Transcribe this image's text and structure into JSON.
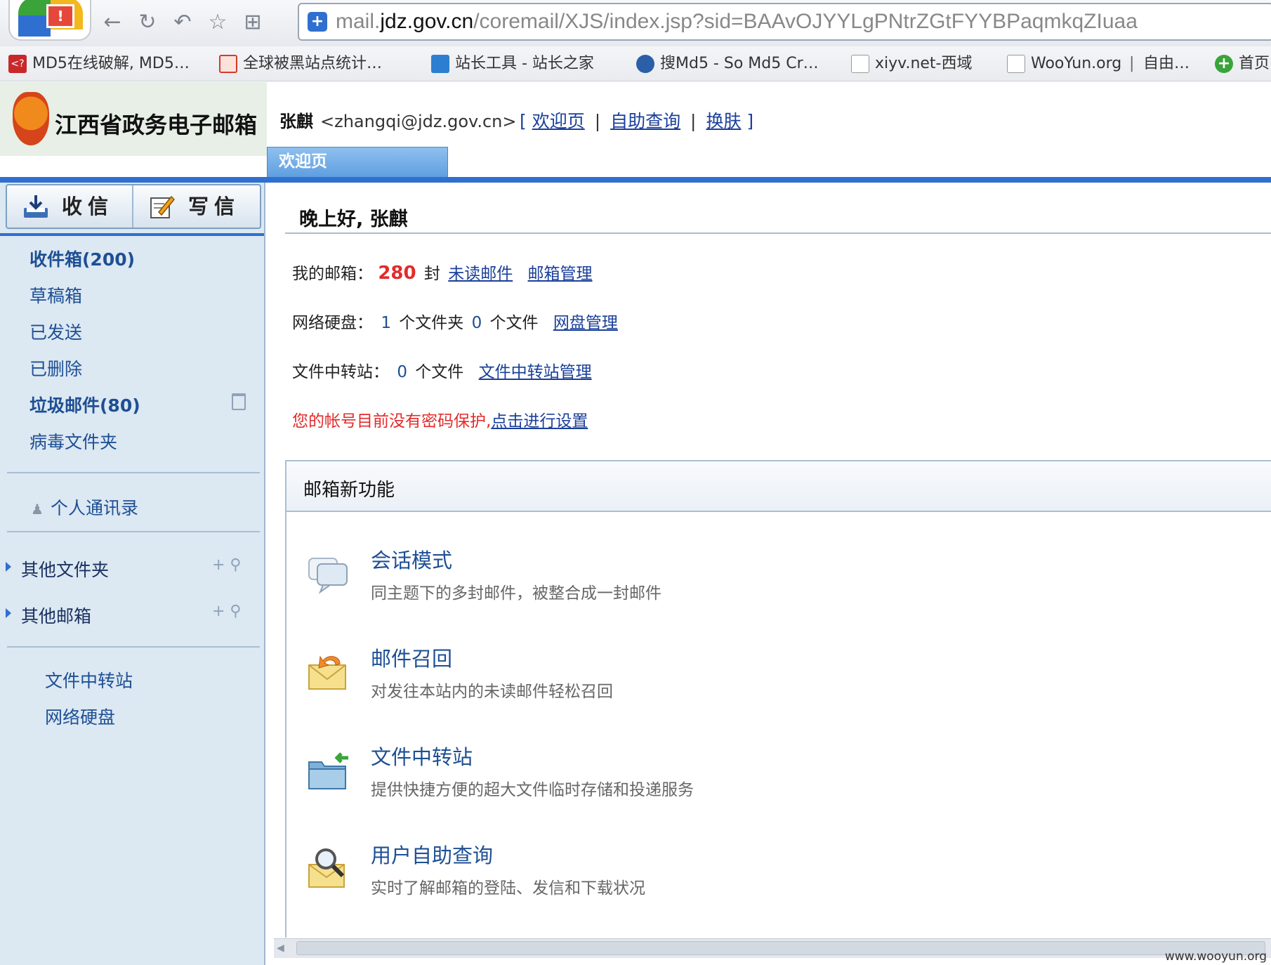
{
  "browser": {
    "url_prefix": "mail.",
    "url_domain": "jdz.gov.cn",
    "url_path": "/coremail/XJS/index.jsp?sid=BAAvOJYYLgPNtrZGtFYYBPaqmkqZIuaa",
    "bookmarks": [
      {
        "label": "MD5在线破解, MD5…",
        "icon_color": "#c8282a"
      },
      {
        "label": "全球被黑站点统计…",
        "icon_color": "#d63a2a"
      },
      {
        "label": "站长工具 - 站长之家",
        "icon_color": "#2c7fd0"
      },
      {
        "label": "搜Md5 - So Md5 Cr…",
        "icon_color": "#2b5fa8"
      },
      {
        "label": "xiyv.net-西域",
        "icon_color": "#ffffff"
      },
      {
        "label": "WooYun.org",
        "icon_color": "#ffffff"
      },
      {
        "label": "自由…",
        "icon_color": ""
      },
      {
        "label": "首页",
        "icon_color": "#3aa43a"
      }
    ],
    "bookmark_separator": "|"
  },
  "header": {
    "site_title": "江西省政务电子邮箱",
    "user_name": "张麒",
    "user_email": "<zhangqi@jdz.gov.cn>",
    "links": [
      "欢迎页",
      "自助查询",
      "换肤"
    ],
    "bracket_open": "[",
    "bracket_close": "]",
    "link_sep": "|",
    "active_tab": "欢迎页"
  },
  "sidebar": {
    "receive_label": "收信",
    "write_label": "写信",
    "folders": [
      "收件箱(200)",
      "草稿箱",
      "已发送",
      "已删除",
      "垃圾邮件(80)",
      "病毒文件夹"
    ],
    "contacts": "个人通讯录",
    "other_folders": "其他文件夹",
    "other_mailboxes": "其他邮箱",
    "tools": [
      "文件中转站",
      "网络硬盘"
    ],
    "action_icons": "+ ⚲"
  },
  "main": {
    "greeting": "晚上好, 张麒",
    "mailbox_label": "我的邮箱：",
    "unread_count": "280",
    "unread_unit": "封",
    "unread_link": "未读邮件",
    "mailbox_manage": "邮箱管理",
    "disk_label": "网络硬盘：",
    "disk_folders": "1",
    "disk_folder_unit": "个文件夹",
    "disk_files": "0",
    "disk_file_unit": "个文件",
    "disk_manage": "网盘管理",
    "transfer_label": "文件中转站：",
    "transfer_files": "0",
    "transfer_unit": "个文件",
    "transfer_manage": "文件中转站管理",
    "warning": "您的帐号目前没有密码保护,",
    "warning_link": "点击进行设置",
    "features_title": "邮箱新功能",
    "features": [
      {
        "title": "会话模式",
        "desc": "同主题下的多封邮件，被整合成一封邮件",
        "icon": "chat-icon"
      },
      {
        "title": "邮件召回",
        "desc": "对发往本站内的未读邮件轻松召回",
        "icon": "mail-recall-icon"
      },
      {
        "title": "文件中转站",
        "desc": "提供快捷方便的超大文件临时存储和投递服务",
        "icon": "folder-transfer-icon"
      },
      {
        "title": "用户自助查询",
        "desc": "实时了解邮箱的登陆、发信和下载状况",
        "icon": "mail-search-icon"
      }
    ]
  },
  "watermark": "www.wooyun.org",
  "colors": {
    "accent": "#2f6fd0",
    "link": "#1a3f9a",
    "sidebar_bg": "#dce8f2",
    "warning": "#e32b2b"
  }
}
